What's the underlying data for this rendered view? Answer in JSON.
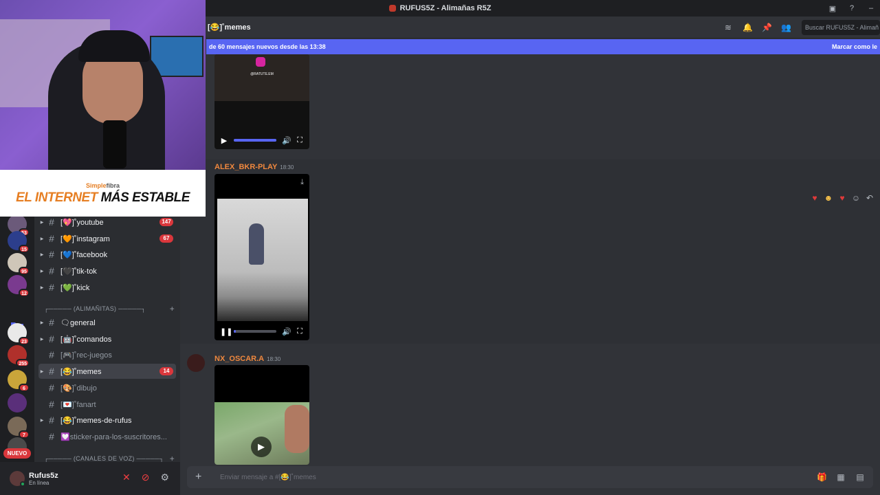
{
  "window": {
    "title": "RUFUS5Z - Alimañas R5Z"
  },
  "overlay": {
    "brand_part1": "Simple",
    "brand_part2": "fibra",
    "slogan_orange": "EL INTERNET",
    "slogan_black": " MÁS ESTABLE"
  },
  "servers": {
    "badges": [
      "53",
      "15",
      "95",
      "12",
      "23",
      "255",
      "6",
      "7"
    ],
    "nuevo": "NUEVO"
  },
  "channels": [
    {
      "label": "[💖]˚youtube",
      "badge": "147"
    },
    {
      "label": "[🧡]˚instagram",
      "badge": "67"
    },
    {
      "label": "[💙]˚facebook",
      "badge": ""
    },
    {
      "label": "[🖤]˚tik-tok",
      "badge": ""
    },
    {
      "label": "[💚]˚kick",
      "badge": ""
    }
  ],
  "categories": {
    "alimanitas": "┌───── (ALIMAÑITAS) ─────┐",
    "voz": "┌───── (CANALES DE VOZ) ─────┐"
  },
  "channels2": [
    {
      "label": "🗨general",
      "badge": ""
    },
    {
      "label": "[🤖]˚comandos",
      "badge": ""
    },
    {
      "label": "[🎮]˚rec-juegos",
      "badge": ""
    },
    {
      "label": "[😂]˚memes",
      "badge": "14"
    },
    {
      "label": "[🎨]˚dibujo",
      "badge": ""
    },
    {
      "label": "[💌]˚fanart",
      "badge": ""
    },
    {
      "label": "[😂]˚memes-de-rufus",
      "badge": ""
    },
    {
      "label": "💟sticker-para-los-suscritores...",
      "badge": ""
    }
  ],
  "user": {
    "name": "Rufus5z",
    "status": "En línea"
  },
  "chat": {
    "channel_name": "[😂]˚memes",
    "search_placeholder": "Buscar RUFUS5Z - Alimañ",
    "new_messages": "de 60 mensajes nuevos desde las 13:38",
    "mark_read": "Marcar como le",
    "composer_placeholder": "Enviar mensaje a #[😂]˚memes"
  },
  "messages": [
    {
      "author": "ALEX_BKR-PLAY",
      "time": "18:30",
      "progress": 0.05
    },
    {
      "author": "NX_OSCAR.A",
      "time": "18:30"
    }
  ],
  "first_video": {
    "watermark": "@RATUTE.EM",
    "progress": 1.0
  },
  "colors": {
    "accent": "#5865f2",
    "author": "#f0883e",
    "mention": "#da373c"
  }
}
